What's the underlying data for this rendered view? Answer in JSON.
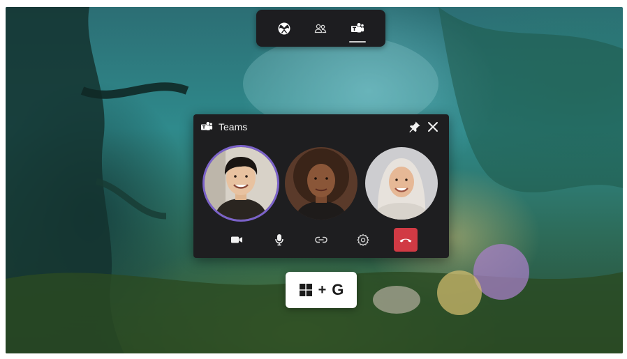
{
  "gamebar": {
    "items": [
      {
        "name": "xbox",
        "icon": "xbox-icon",
        "active": false
      },
      {
        "name": "social",
        "icon": "people-icon",
        "active": false
      },
      {
        "name": "teams",
        "icon": "teams-icon",
        "active": true
      }
    ]
  },
  "teams_widget": {
    "title": "Teams",
    "header_icons": [
      "teams-logo-icon",
      "pin-icon",
      "close-icon"
    ],
    "participants": [
      {
        "name": "participant-1",
        "speaking": true,
        "skin": "#e8c2a0",
        "hair": "#1a1512",
        "bg": "#d8d2c8",
        "shirt": "#2a2520"
      },
      {
        "name": "participant-2",
        "speaking": false,
        "skin": "#8a5638",
        "hair": "#3a2418",
        "bg": "#5a3a2a",
        "shirt": "#1e1b1a"
      },
      {
        "name": "participant-3",
        "speaking": false,
        "skin": "#e6b896",
        "hair": "#e7e2dc",
        "bg": "#cdcdd0",
        "shirt": "#d8d3cc"
      }
    ],
    "controls": [
      {
        "name": "camera-button",
        "icon": "camera-icon"
      },
      {
        "name": "microphone-button",
        "icon": "microphone-icon"
      },
      {
        "name": "share-button",
        "icon": "share-icon"
      },
      {
        "name": "settings-button",
        "icon": "gear-icon"
      },
      {
        "name": "hang-up-button",
        "icon": "phone-hangup-icon"
      }
    ]
  },
  "shortcut": {
    "windows_key": "windows-logo-icon",
    "plus": "+",
    "key": "G"
  },
  "colors": {
    "panel": "#1e1e20",
    "hangup": "#d13a44",
    "speaking_ring": "#7b62c9"
  }
}
